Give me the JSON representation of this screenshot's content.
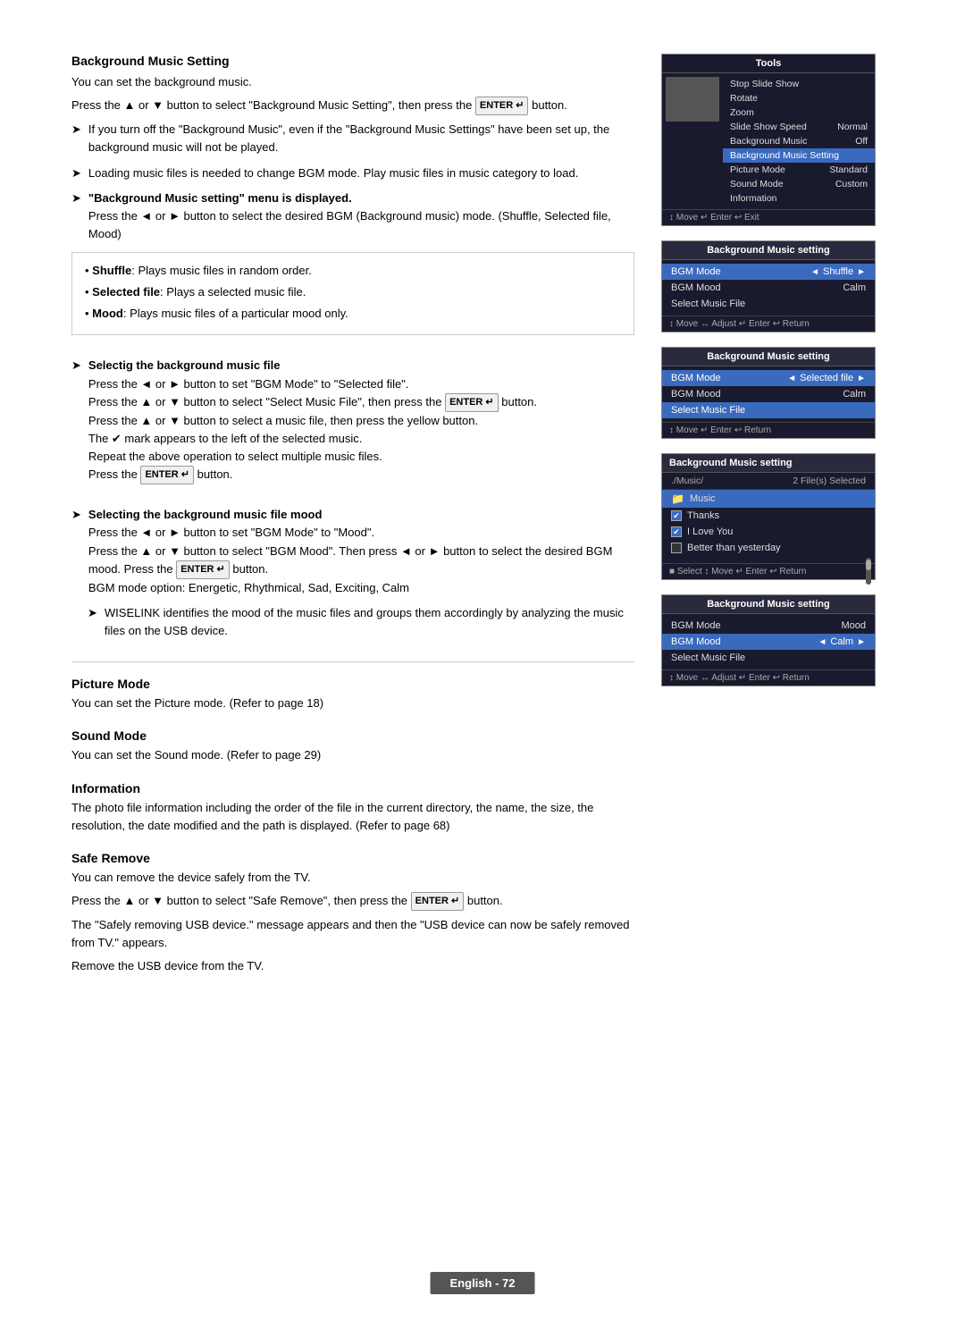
{
  "page": {
    "number_label": "English - 72"
  },
  "sections": {
    "bgm_setting": {
      "title": "Background Music Setting",
      "intro": "You can set the background music.",
      "instruction1_prefix": "Press the ▲ or ▼ button to select \"Background Music Setting\", then press the",
      "enter_btn": "ENTER",
      "enter_sym": "↵",
      "instruction1_suffix": "button.",
      "note1": "If you turn off the \"Background Music\", even if the \"Background Music Settings\" have been set up, the background music will not be played.",
      "note2": "Loading music files is needed to change BGM mode. Play music files in music category to load.",
      "bgm_menu_displayed": "\"Background Music setting\" menu is displayed.",
      "bgm_menu_instruction": "Press the ◄ or ► button to select the desired BGM (Background music) mode. (Shuffle, Selected file, Mood)",
      "shuffle_label": "Shuffle",
      "shuffle_desc": "Plays music files in random order.",
      "selected_file_label": "Selected file",
      "selected_file_desc": "Plays a selected music file.",
      "mood_label": "Mood",
      "mood_desc": "Plays music files of a particular mood only."
    },
    "select_bgm_file": {
      "title": "Selectig the background music file",
      "step1": "Press the ◄ or ► button to set \"BGM Mode\" to \"Selected file\".",
      "step2": "Press the ▲ or ▼ button to select \"Select Music File\", then press the",
      "enter_btn": "ENTER",
      "step2_suffix": "button.",
      "step3": "Press the ▲ or ▼ button to select a music file, then press the yellow button.",
      "checkmark_note": "The ✔ mark appears to the left of the selected music.",
      "repeat_note": "Repeat the above operation to select multiple music files.",
      "press_enter": "Press the",
      "press_enter_btn": "ENTER",
      "press_enter_suffix": "button."
    },
    "bgm_mood": {
      "title": "Selecting the background music file mood",
      "step1": "Press the ◄ or ► button to set \"BGM Mode\" to \"Mood\".",
      "step2": "Press the ▲ or ▼ button to select \"BGM Mood\". Then press ◄ or ► button to select the desired BGM mood. Press the",
      "enter_btn": "ENTER",
      "step2_suffix": "button.",
      "options_prefix": "BGM mode option: Energetic, Rhythmical, Sad, Exciting, Calm",
      "wiselink_note": "WISELINK identifies the mood of the music files and groups them accordingly by analyzing the music files on the USB device."
    },
    "picture_mode": {
      "title": "Picture Mode",
      "desc": "You can set the Picture mode. (Refer to page 18)"
    },
    "sound_mode": {
      "title": "Sound Mode",
      "desc": "You can set the Sound mode. (Refer to page 29)"
    },
    "information": {
      "title": "Information",
      "desc": "The photo file information including the order of the file in the current directory, the name, the size, the resolution, the date modified and the path is displayed. (Refer to page 68)"
    },
    "safe_remove": {
      "title": "Safe Remove",
      "desc1": "You can remove the device safely from the TV.",
      "step1_prefix": "Press the ▲ or ▼ button to select \"Safe Remove\", then press the",
      "enter_btn": "ENTER",
      "step1_suffix": "button.",
      "step2": "The \"Safely removing USB device.\" message appears and then the \"USB device can now be safely removed from TV.\" appears.",
      "step3": "Remove the USB device from the TV."
    }
  },
  "panels": {
    "tools": {
      "title": "Tools",
      "items": [
        {
          "label": "Stop Slide Show",
          "value": "",
          "highlighted": false
        },
        {
          "label": "Rotate",
          "value": "",
          "highlighted": false
        },
        {
          "label": "Zoom",
          "value": "",
          "highlighted": false
        },
        {
          "label": "Slide Show Speed",
          "value": "Normal",
          "highlighted": false
        },
        {
          "label": "Background Music",
          "value": "Off",
          "highlighted": false
        },
        {
          "label": "Background Music Setting",
          "value": "",
          "highlighted": true
        },
        {
          "label": "Picture Mode",
          "value": "Standard",
          "highlighted": false
        },
        {
          "label": "Sound Mode",
          "value": "Custom",
          "highlighted": false
        },
        {
          "label": "Information",
          "value": "",
          "highlighted": false
        }
      ],
      "footer": "↕ Move  ↵ Enter  ↩ Exit"
    },
    "bgm_shuffle": {
      "title": "Background Music setting",
      "rows": [
        {
          "label": "BGM Mode",
          "value": "Shuffle",
          "has_arrows": true,
          "highlighted": true
        },
        {
          "label": "BGM Mood",
          "value": "Calm",
          "has_arrows": false,
          "highlighted": false
        },
        {
          "label": "Select Music File",
          "value": "",
          "has_arrows": false,
          "highlighted": false
        }
      ],
      "footer": "↕ Move  ↔ Adjust  ↵ Enter  ↩ Return"
    },
    "bgm_selected": {
      "title": "Background Music setting",
      "rows": [
        {
          "label": "BGM Mode",
          "value": "Selected file",
          "has_arrows": true,
          "highlighted": true
        },
        {
          "label": "BGM Mood",
          "value": "Calm",
          "has_arrows": false,
          "highlighted": false
        },
        {
          "label": "Select Music File",
          "value": "",
          "has_arrows": false,
          "highlighted": false,
          "selected_row": true
        }
      ],
      "footer": "↕ Move  ↵ Enter  ↩ Return"
    },
    "file_list": {
      "title": "Background Music setting",
      "path": "./Music/",
      "files_selected": "2 File(s) Selected",
      "files": [
        {
          "name": "Music",
          "type": "folder",
          "checked": false
        },
        {
          "name": "Thanks",
          "type": "file",
          "checked": true
        },
        {
          "name": "I Love You",
          "type": "file",
          "checked": true
        },
        {
          "name": "Better than yesterday",
          "type": "file",
          "checked": false
        }
      ],
      "footer": "■ Select  ↕ Move  ↵ Enter  ↩ Return"
    },
    "bgm_mood": {
      "title": "Background Music setting",
      "rows": [
        {
          "label": "BGM Mode",
          "value": "Mood",
          "has_arrows": false,
          "highlighted": false
        },
        {
          "label": "BGM Mood",
          "value": "Calm",
          "has_arrows": true,
          "highlighted": true
        },
        {
          "label": "Select Music File",
          "value": "",
          "has_arrows": false,
          "highlighted": false
        }
      ],
      "footer": "↕ Move  ↔ Adjust  ↵ Enter  ↩ Return"
    }
  }
}
